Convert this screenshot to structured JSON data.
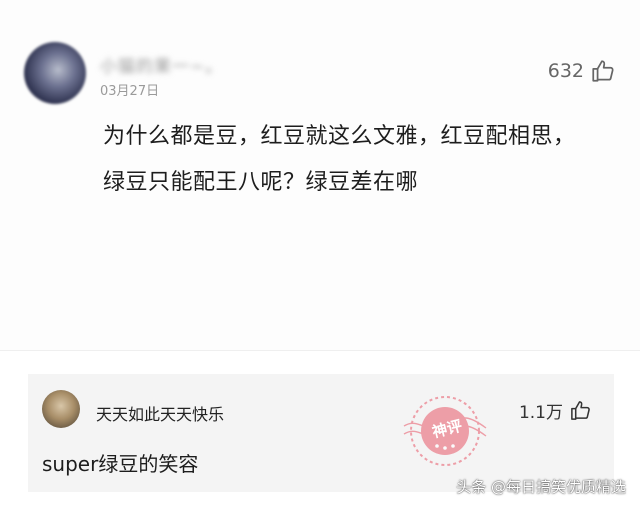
{
  "main_comment": {
    "username": "小猫的果一~。",
    "date": "03月27日",
    "likes": "632",
    "text_line1": "为什么都是豆，红豆就这么文雅，红豆配相思，",
    "text_line2": "绿豆只能配王八呢？绿豆差在哪"
  },
  "reply": {
    "username": "天天如此天天快乐",
    "likes": "1.1万",
    "text": "super绿豆的笑容"
  },
  "stamp": {
    "text": "神评"
  },
  "watermark": {
    "text": "头条 @每日搞笑优质精选"
  },
  "icons": {
    "like": "thumbs-up-icon",
    "avatar": "avatar"
  },
  "colors": {
    "stamp": "#e8586a",
    "text": "#1d1d1d",
    "muted": "#9a9a9a",
    "reply_bg": "#f4f4f4"
  }
}
